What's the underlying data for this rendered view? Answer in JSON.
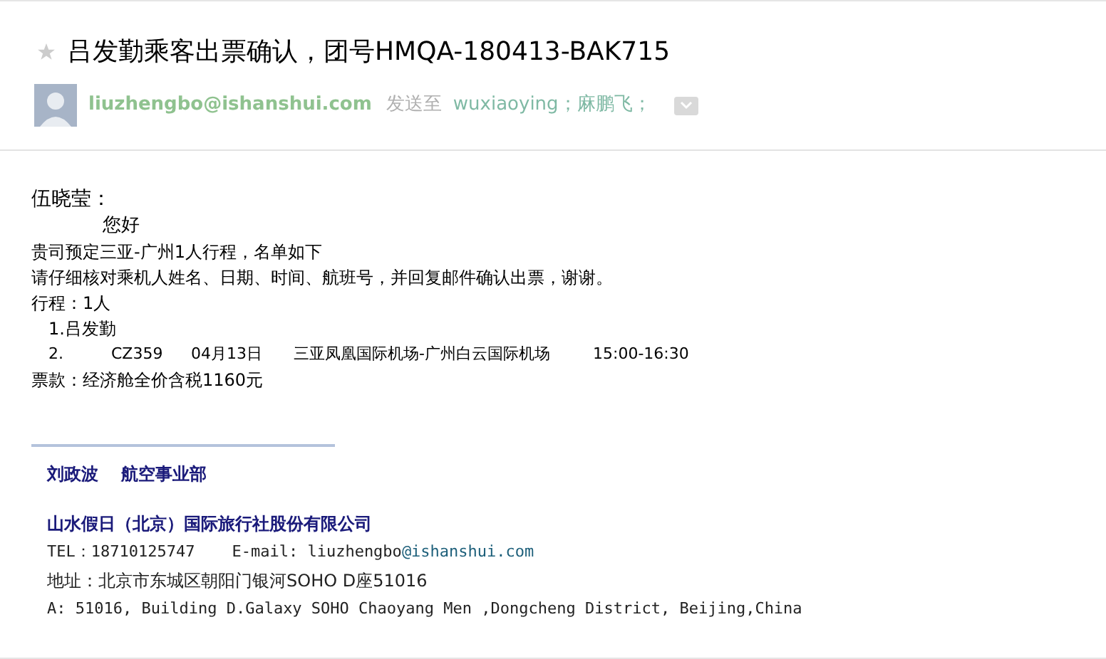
{
  "subject": {
    "starred": false,
    "title": "吕发勤乘客出票确认，团号HMQA-180413-BAK715"
  },
  "sender": {
    "email": "liuzhengbo@ishanshui.com",
    "sent_to_label": "发送至",
    "recipients": [
      "wuxiaoying；",
      "麻鹏飞；"
    ]
  },
  "body": {
    "greeting": "伍晓莹：",
    "salutation": "您好",
    "lines": [
      "贵司预定三亚-广州1人行程，名单如下",
      "请仔细核对乘机人姓名、日期、时间、航班号，并回复邮件确认出票，谢谢。",
      "行程：1人"
    ],
    "passenger": "1.吕发勤",
    "flight": [
      "2.",
      "CZ359",
      "04月13日",
      "三亚凤凰国际机场-广州白云国际机场",
      "15:00-16:30"
    ],
    "fare": "票款：经济舱全价含税1160元"
  },
  "signature": {
    "name": "刘政波",
    "department": "航空事业部",
    "company": "山水假日（北京）国际旅行社股份有限公司",
    "tel": "TEL：18710125747",
    "email_label": "E-mail:",
    "email_user": "liuzhengbo",
    "email_domain": "@ishanshui.com",
    "address": "地址：北京市东城区朝阳门银河SOHO D座51016",
    "address_en": "A: 51016,  Building D.Galaxy SOHO Chaoyang Men ,Dongcheng District, Beijing,China"
  }
}
